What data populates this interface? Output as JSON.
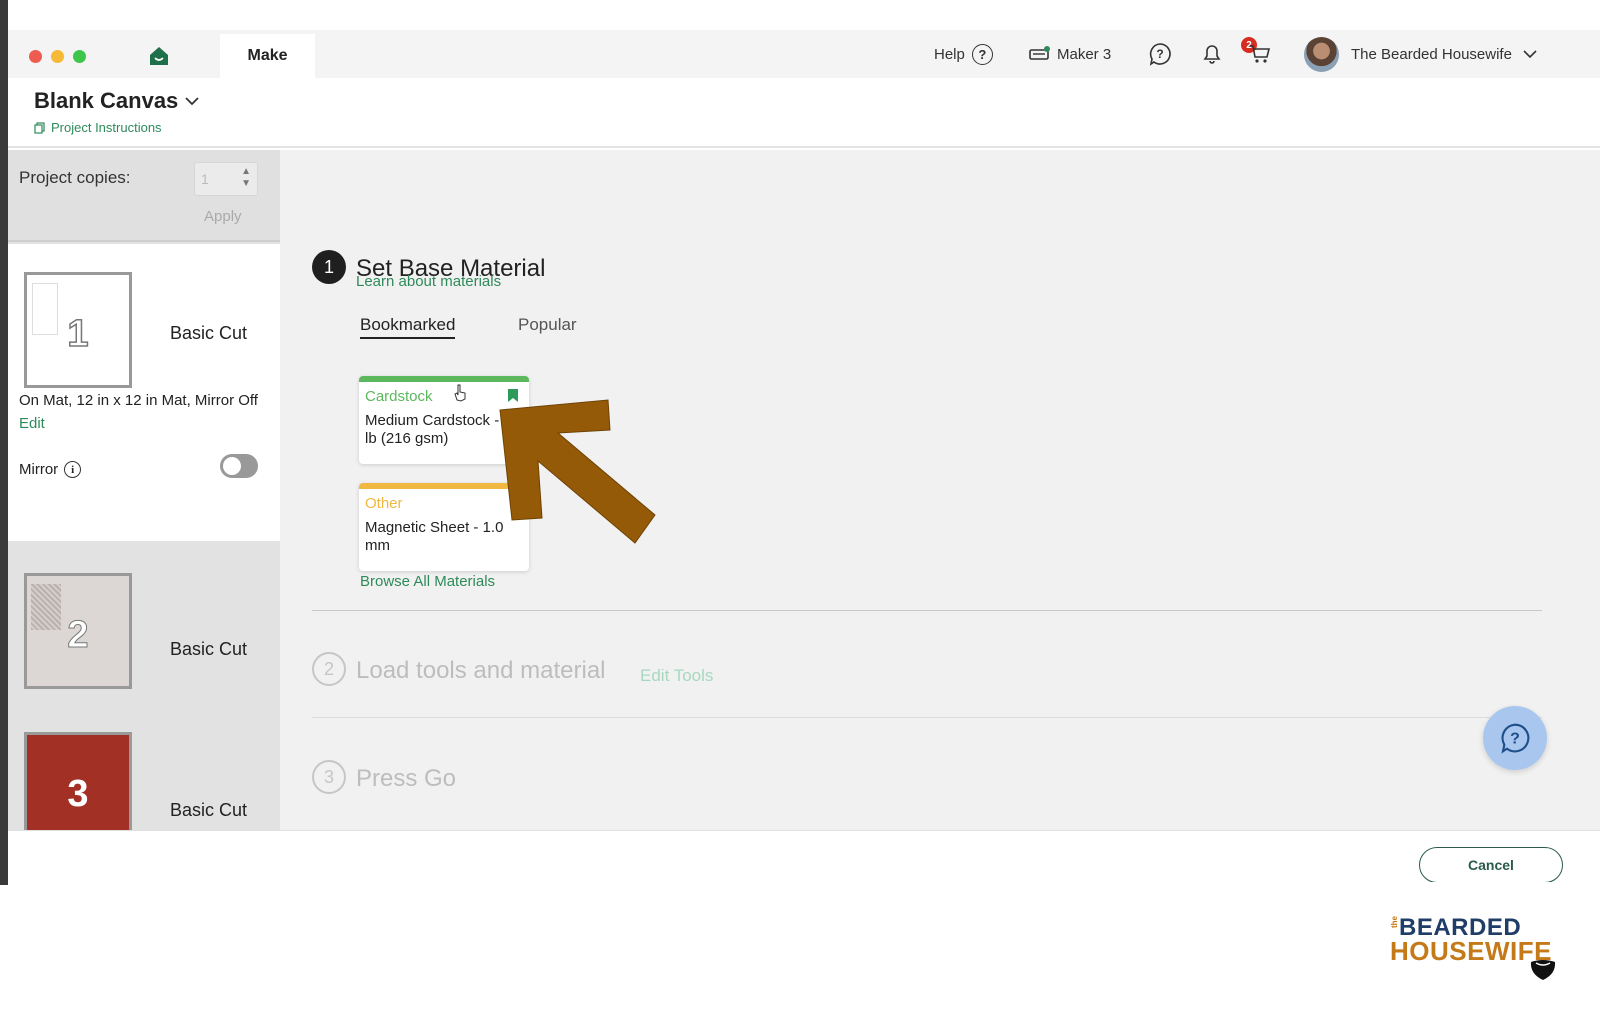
{
  "titlebar": {
    "make_tab": "Make",
    "help_label": "Help",
    "machine_label": "Maker 3",
    "notification_count": "2",
    "user_name": "The Bearded Housewife"
  },
  "header": {
    "project_title": "Blank Canvas",
    "instructions_link": "Project Instructions"
  },
  "sidebar": {
    "copies_label": "Project copies:",
    "copies_value": "1",
    "apply_label": "Apply",
    "mats": [
      {
        "number": "1",
        "label": "Basic Cut",
        "color": "#ffffff"
      },
      {
        "number": "2",
        "label": "Basic Cut",
        "color": "#dcd7d5"
      },
      {
        "number": "3",
        "label": "Basic Cut",
        "color": "#a33024"
      }
    ],
    "mat_info": "On Mat, 12 in x 12 in Mat, Mirror Off",
    "edit_label": "Edit",
    "mirror_label": "Mirror",
    "mirror_on": false
  },
  "main": {
    "steps": [
      {
        "number": "1",
        "title": "Set Base Material",
        "active": true
      },
      {
        "number": "2",
        "title": "Load tools and material",
        "active": false
      },
      {
        "number": "3",
        "title": "Press Go",
        "active": false
      }
    ],
    "learn_link": "Learn about materials",
    "tabs": {
      "bookmarked": "Bookmarked",
      "popular": "Popular"
    },
    "materials": [
      {
        "category": "Cardstock",
        "name": "Medium Cardstock - 80 lb (216 gsm)",
        "color": "#5cb85c",
        "bookmarked": true
      },
      {
        "category": "Other",
        "name": "Magnetic Sheet - 1.0 mm",
        "color": "#f0b840",
        "bookmarked": false
      }
    ],
    "browse_link": "Browse All Materials",
    "edit_tools_link": "Edit Tools"
  },
  "footer": {
    "cancel_label": "Cancel"
  },
  "watermark": {
    "the": "the",
    "line1": "BEARDED",
    "line2": "HOUSEWIFE"
  },
  "colors": {
    "accent_green": "#2e8a5a",
    "arrow_brown": "#955a07"
  }
}
